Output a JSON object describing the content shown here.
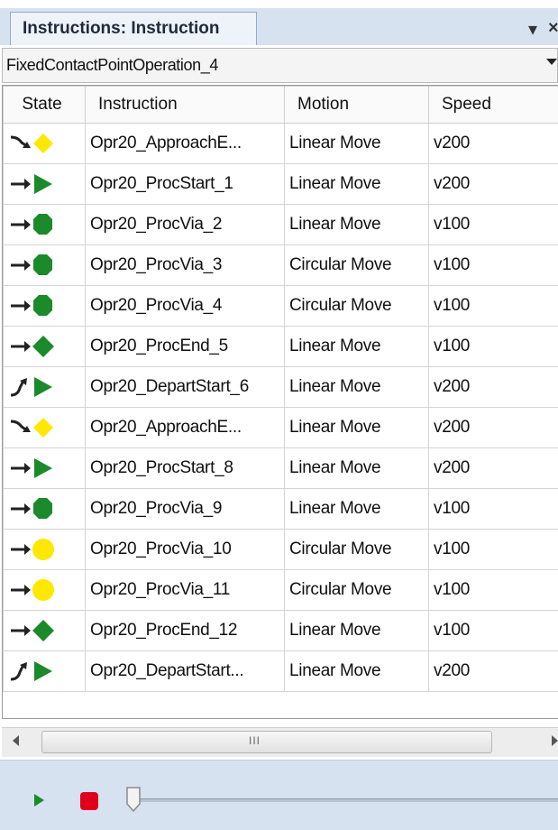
{
  "panel": {
    "tab_title": "Instructions: Instruction",
    "pin_glyph": "▾",
    "close_glyph": "×"
  },
  "operation": {
    "selected": "FixedContactPointOperation_4"
  },
  "grid": {
    "columns": [
      "State",
      "Instruction",
      "Motion",
      "Speed"
    ],
    "rows": [
      {
        "state": "approach-yellow-diamond",
        "instruction": "Opr20_ApproachE...",
        "motion": "Linear Move",
        "speed": "v200"
      },
      {
        "state": "start-green-triangle",
        "instruction": "Opr20_ProcStart_1",
        "motion": "Linear Move",
        "speed": "v200"
      },
      {
        "state": "via-green-octagon",
        "instruction": "Opr20_ProcVia_2",
        "motion": "Linear Move",
        "speed": "v100"
      },
      {
        "state": "via-green-octagon",
        "instruction": "Opr20_ProcVia_3",
        "motion": "Circular Move",
        "speed": "v100"
      },
      {
        "state": "via-green-octagon",
        "instruction": "Opr20_ProcVia_4",
        "motion": "Circular Move",
        "speed": "v100"
      },
      {
        "state": "end-green-diamond",
        "instruction": "Opr20_ProcEnd_5",
        "motion": "Linear Move",
        "speed": "v100"
      },
      {
        "state": "depart-green-triangle",
        "instruction": "Opr20_DepartStart_6",
        "motion": "Linear Move",
        "speed": "v200"
      },
      {
        "state": "approach-yellow-diamond",
        "instruction": "Opr20_ApproachE...",
        "motion": "Linear Move",
        "speed": "v200"
      },
      {
        "state": "start-green-triangle",
        "instruction": "Opr20_ProcStart_8",
        "motion": "Linear Move",
        "speed": "v200"
      },
      {
        "state": "via-green-octagon",
        "instruction": "Opr20_ProcVia_9",
        "motion": "Linear Move",
        "speed": "v100"
      },
      {
        "state": "via-yellow-circle",
        "instruction": "Opr20_ProcVia_10",
        "motion": "Circular Move",
        "speed": "v100"
      },
      {
        "state": "via-yellow-circle",
        "instruction": "Opr20_ProcVia_11",
        "motion": "Circular Move",
        "speed": "v100"
      },
      {
        "state": "end-green-diamond",
        "instruction": "Opr20_ProcEnd_12",
        "motion": "Linear Move",
        "speed": "v100"
      },
      {
        "state": "depart-green-triangle",
        "instruction": "Opr20_DepartStart...",
        "motion": "Linear Move",
        "speed": "v200"
      }
    ]
  },
  "scrollbar": {
    "grip_glyph": "III"
  },
  "player": {
    "play_icon": "play-icon",
    "stop_icon": "stop-icon",
    "slider_value": 0
  },
  "colors": {
    "panel_bg": "#d7e2f0",
    "green": "#1b8a2a",
    "yellow": "#ffe800",
    "stop_red": "#e0001b"
  }
}
